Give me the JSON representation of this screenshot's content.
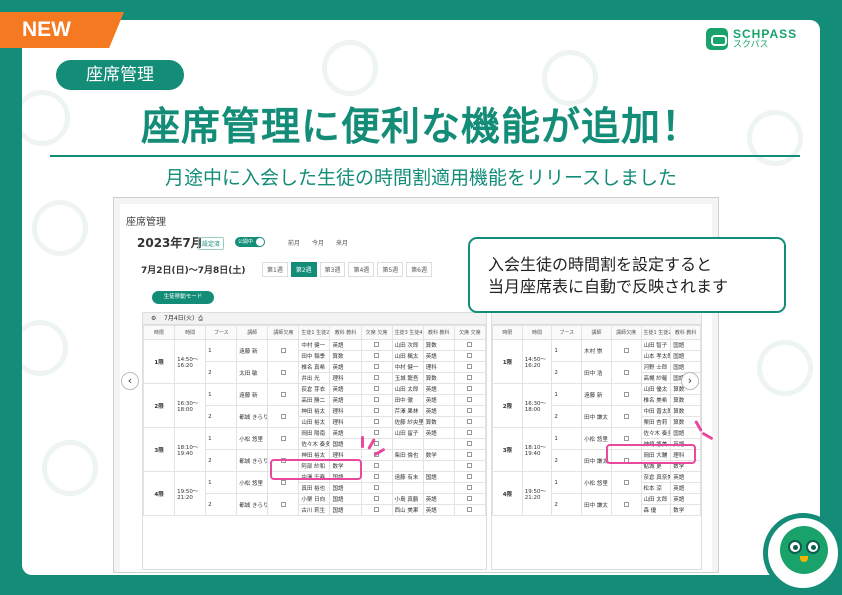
{
  "banner": {
    "new_tag": "NEW",
    "logo_name": "SCHPASS",
    "logo_sub": "スクパス",
    "category": "座席管理",
    "headline": "座席管理に便利な機能が追加！",
    "subheadline": "月途中に入会した生徒の時間割適用機能をリリースしました",
    "callout_line1": "入会生徒の時間割を設定すると",
    "callout_line2": "当月座席表に自動で反映されます"
  },
  "app": {
    "title": "座席管理",
    "month": "2023年7月",
    "settings_button": "設定済",
    "publish_toggle": "公開中",
    "month_links": [
      "前月",
      "今月",
      "来月"
    ],
    "week_range": "7月2日(日)〜7月8日(土)",
    "week_tabs": [
      "第1週",
      "第2週",
      "第3週",
      "第4週",
      "第5週",
      "第6週"
    ],
    "active_week": "第2週",
    "mode_button": "生徒移動モード",
    "left_panel": {
      "date": "7月4日(火)",
      "columns": [
        "時限",
        "時間",
        "ブース",
        "講師",
        "講師欠席",
        "生徒1 生徒2",
        "教科 教科",
        "欠席 欠席",
        "生徒3 生徒4",
        "教科 教科",
        "欠席 欠席"
      ],
      "periods": [
        {
          "name": "1限",
          "time": "14:50〜16:20",
          "booths": [
            {
              "no": "1",
              "teacher": "遠藤 新",
              "rows": [
                [
                  "中村 健一",
                  "英語",
                  "山田 次郎",
                  "算数"
                ],
                [
                  "田中 稲季",
                  "算数",
                  "山田 楓太",
                  "英語"
                ]
              ]
            },
            {
              "no": "2",
              "teacher": "太田 敏",
              "rows": [
                [
                  "椎名 真希",
                  "英語",
                  "中村 健一",
                  "理科"
                ],
                [
                  "井出 光",
                  "理科",
                  "玉城 龍吾",
                  "算数"
                ]
              ]
            }
          ]
        },
        {
          "name": "2限",
          "time": "16:30〜18:00",
          "booths": [
            {
              "no": "1",
              "teacher": "遠藤 新",
              "rows": [
                [
                  "荻倉 芽衣",
                  "英語",
                  "山田 太郎",
                  "英語"
                ],
                [
                  "高田 勝二",
                  "英語",
                  "田中 徹",
                  "英語"
                ]
              ]
            },
            {
              "no": "2",
              "teacher": "都城 きらり",
              "rows": [
                [
                  "神田 裕太",
                  "理科",
                  "芹澤 果林",
                  "英語"
                ],
                [
                  "山田 裕太",
                  "理科",
                  "佐藤 紗央里",
                  "算数"
                ]
              ]
            }
          ]
        },
        {
          "name": "3限",
          "time": "18:10〜19:40",
          "booths": [
            {
              "no": "1",
              "teacher": "小松 悠里",
              "rows": [
                [
                  "岡田 陽南",
                  "英語",
                  "山田 留子",
                  "英語"
                ],
                [
                  "佐々木 奏多",
                  "国語",
                  "",
                  ""
                ]
              ]
            },
            {
              "no": "2",
              "teacher": "都城 きらり",
              "rows": [
                [
                  "神田 裕太",
                  "理科",
                  "柴田 倫也",
                  "数学"
                ],
                [
                  "阿部 紗和",
                  "数学",
                  "",
                  ""
                ]
              ]
            }
          ]
        },
        {
          "name": "4限",
          "time": "19:50〜21:20",
          "booths": [
            {
              "no": "1",
              "teacher": "小松 悠里",
              "rows": [
                [
                  "中澤 千春",
                  "国語",
                  "遠藤 有未",
                  "国語"
                ],
                [
                  "真田 裕也",
                  "国語",
                  "",
                  ""
                ]
              ]
            },
            {
              "no": "2",
              "teacher": "都城 きらり",
              "rows": [
                [
                  "小栗 日向",
                  "国語",
                  "小島 真鶴",
                  "英語"
                ],
                [
                  "古川 莉生",
                  "国語",
                  "西山 美果",
                  "英語"
                ]
              ]
            }
          ]
        }
      ]
    },
    "right_panel": {
      "columns": [
        "時限",
        "時間",
        "ブース",
        "講師",
        "講師欠席",
        "生徒1 生徒2",
        "教科 教科"
      ],
      "periods": [
        {
          "name": "1限",
          "time": "14:50〜16:20",
          "booths": [
            {
              "no": "1",
              "teacher": "木村 崇",
              "rows": [
                [
                  "山田 智子",
                  "国語"
                ],
                [
                  "山本 孝太郎",
                  "国語"
                ]
              ]
            },
            {
              "no": "2",
              "teacher": "田中 浩",
              "rows": [
                [
                  "河野 士郎",
                  "国語"
                ],
                [
                  "高槻 紗羅",
                  "国語"
                ]
              ]
            }
          ]
        },
        {
          "name": "2限",
          "time": "16:30〜18:00",
          "booths": [
            {
              "no": "1",
              "teacher": "遠藤 新",
              "rows": [
                [
                  "山田 優太",
                  "算数"
                ],
                [
                  "椎名 美希",
                  "算数"
                ]
              ]
            },
            {
              "no": "2",
              "teacher": "田中 謙太",
              "rows": [
                [
                  "中田 晋太郎",
                  "算数"
                ],
                [
                  "栗田 杏莉",
                  "算数"
                ]
              ]
            }
          ]
        },
        {
          "name": "3限",
          "time": "18:10〜19:40",
          "booths": [
            {
              "no": "1",
              "teacher": "小松 悠里",
              "rows": [
                [
                  "佐々木 奏多",
                  "国語"
                ],
                [
                  "神崎 悠美",
                  "英語"
                ]
              ]
            },
            {
              "no": "2",
              "teacher": "田中 謙太",
              "rows": [
                [
                  "岡田 大輔",
                  "理科"
                ],
                [
                  "鮎城 更",
                  "数学"
                ]
              ]
            }
          ]
        },
        {
          "name": "4限",
          "time": "19:50〜21:20",
          "booths": [
            {
              "no": "1",
              "teacher": "小松 悠里",
              "rows": [
                [
                  "奈倉 真奈美",
                  "英語"
                ],
                [
                  "松本 涼",
                  "英語"
                ]
              ]
            },
            {
              "no": "2",
              "teacher": "田中 謙太",
              "rows": [
                [
                  "山田 太郎",
                  "英語"
                ],
                [
                  "森 優",
                  "数学"
                ]
              ]
            }
          ]
        }
      ]
    }
  },
  "icons": [
    "chevron-left-icon",
    "chevron-right-icon",
    "print-icon",
    "settings-icon",
    "schpass-logo-icon",
    "owl-mascot-icon"
  ],
  "colors": {
    "brand": "#138d77",
    "accent": "#f47920",
    "highlight": "#e8489d"
  }
}
